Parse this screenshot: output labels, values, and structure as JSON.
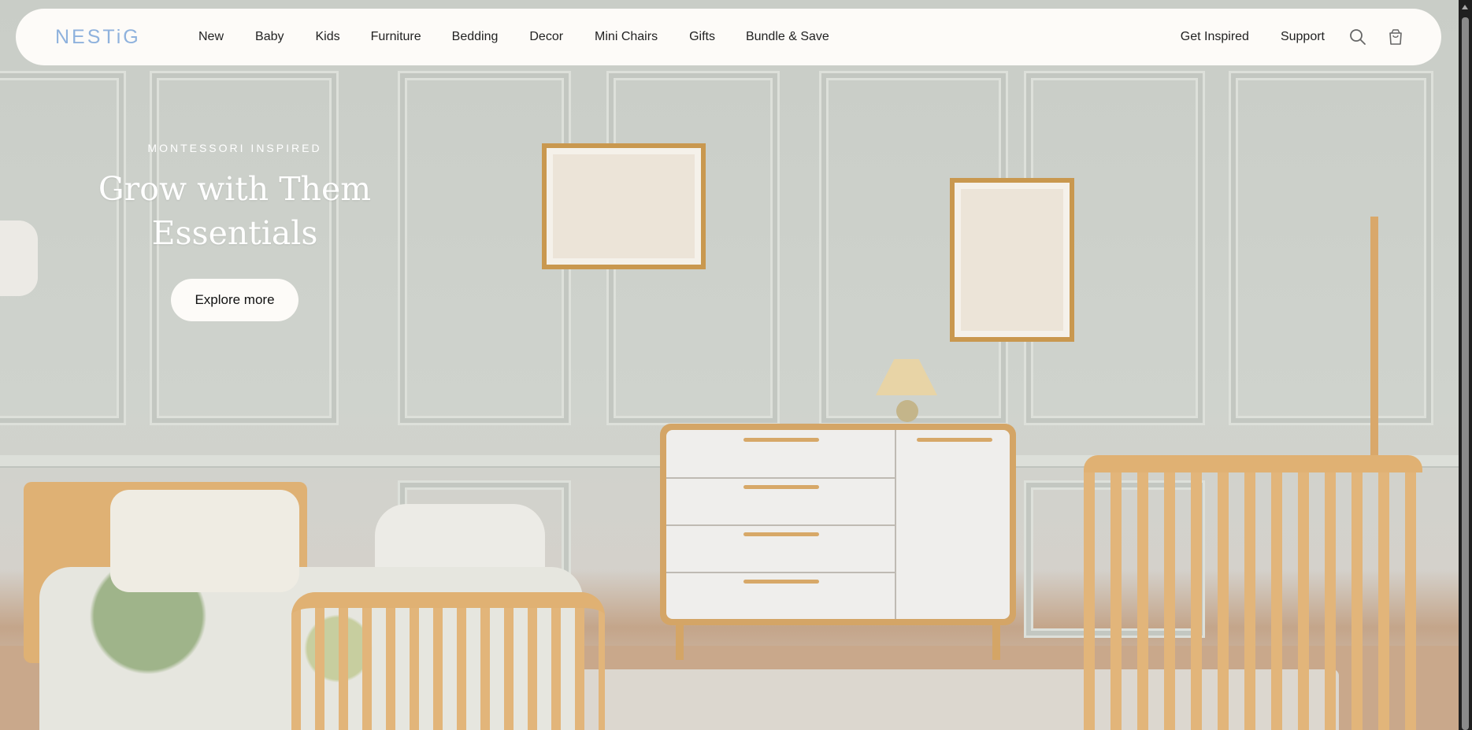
{
  "brand": {
    "logo_text": "NESTiG",
    "logo_color": "#8fb2dd"
  },
  "nav": {
    "items": [
      "New",
      "Baby",
      "Kids",
      "Furniture",
      "Bedding",
      "Decor",
      "Mini Chairs",
      "Gifts",
      "Bundle & Save"
    ],
    "right_items": [
      "Get Inspired",
      "Support"
    ],
    "icons": [
      "search-icon",
      "cart-icon"
    ]
  },
  "hero": {
    "eyebrow": "MONTESSORI INSPIRED",
    "headline_line1": "Grow with Them",
    "headline_line2": "Essentials",
    "cta_label": "Explore more"
  }
}
